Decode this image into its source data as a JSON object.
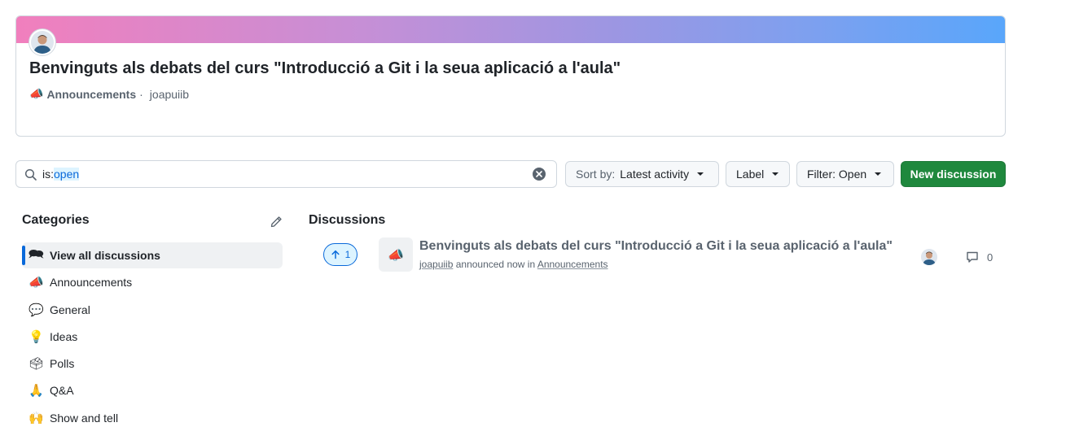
{
  "featured": {
    "title": "Benvinguts als debats del curs \"Introducció a Git i la seua aplicació a l'aula\"",
    "category_emoji": "📣",
    "category": "Announcements",
    "separator": "·",
    "author": "joapuiib",
    "banner_colors": [
      "#f17fbd",
      "#c68fd6",
      "#9d96e2",
      "#7ea0ef",
      "#59a6fb"
    ]
  },
  "search": {
    "query_prefix": "is:",
    "query_value": "open",
    "icon": "search-icon",
    "clear_icon": "x-circle-icon"
  },
  "toolbar": {
    "sort_prefix": "Sort by:",
    "sort_value": "Latest activity",
    "label_button": "Label",
    "filter_button": "Filter: Open",
    "new_discussion": "New discussion"
  },
  "sidebar": {
    "heading": "Categories",
    "edit_icon": "pencil-icon",
    "items": [
      {
        "emoji": "🗪",
        "label": "View all discussions",
        "active": true
      },
      {
        "emoji": "📣",
        "label": "Announcements"
      },
      {
        "emoji": "💬",
        "label": "General"
      },
      {
        "emoji": "💡",
        "label": "Ideas"
      },
      {
        "emoji": "🗳",
        "label": "Polls"
      },
      {
        "emoji": "🙏",
        "label": "Q&A"
      },
      {
        "emoji": "🙌",
        "label": "Show and tell"
      }
    ]
  },
  "discussions": {
    "heading": "Discussions",
    "items": [
      {
        "upvotes": "1",
        "category_emoji": "📣",
        "title": "Benvinguts als debats del curs \"Introducció a Git i la seua aplicació a l'aula\"",
        "author": "joapuiib",
        "action": "announced now in",
        "category": "Announcements",
        "comments": "0"
      }
    ]
  },
  "colors": {
    "accent": "#0969da",
    "primary_button": "#1f883d",
    "muted_text": "#59636e"
  }
}
